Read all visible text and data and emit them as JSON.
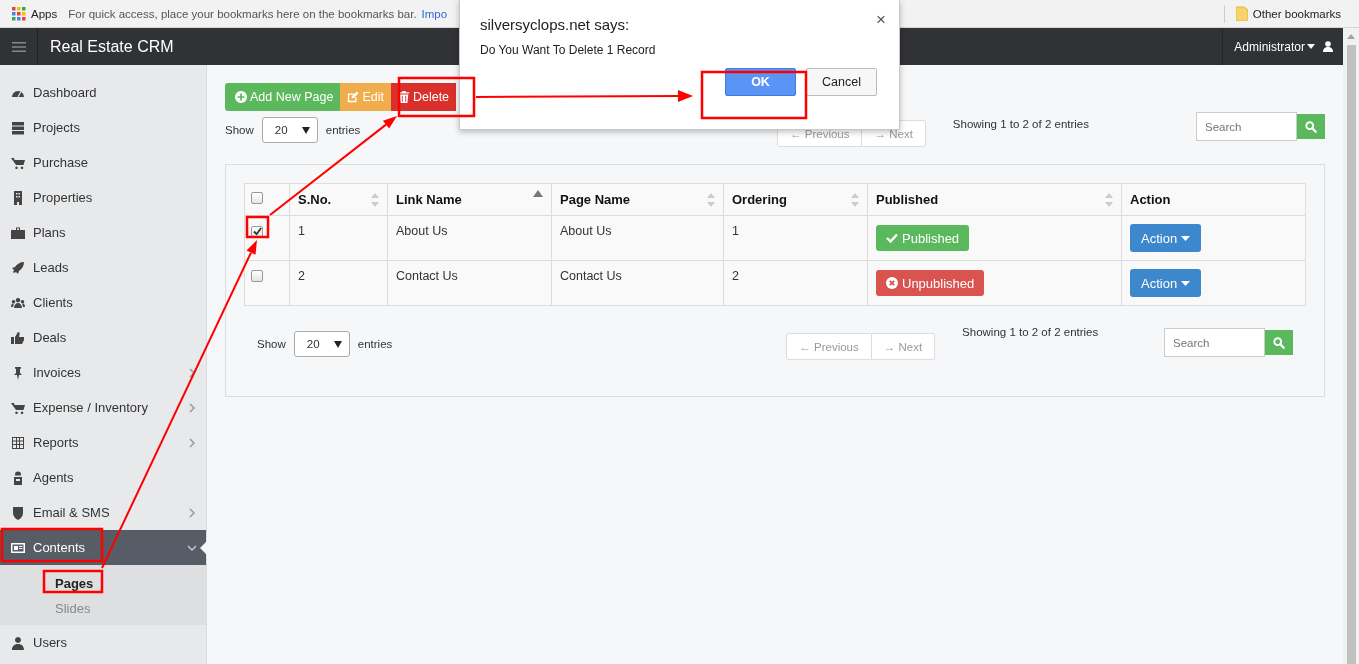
{
  "bookmarks_bar": {
    "apps_label": "Apps",
    "hint": "For quick access, place your bookmarks here on the bookmarks bar.",
    "link": "Impo",
    "other": "Other bookmarks"
  },
  "navbar": {
    "title": "Real Estate CRM",
    "user": "Administrator"
  },
  "sidebar": {
    "items": [
      {
        "label": "Dashboard",
        "selected": false,
        "expandable": false
      },
      {
        "label": "Projects",
        "selected": false,
        "expandable": false
      },
      {
        "label": "Purchase",
        "selected": false,
        "expandable": false
      },
      {
        "label": "Properties",
        "selected": false,
        "expandable": false
      },
      {
        "label": "Plans",
        "selected": false,
        "expandable": false
      },
      {
        "label": "Leads",
        "selected": false,
        "expandable": false
      },
      {
        "label": "Clients",
        "selected": false,
        "expandable": false
      },
      {
        "label": "Deals",
        "selected": false,
        "expandable": false
      },
      {
        "label": "Invoices",
        "selected": false,
        "expandable": true,
        "expanded": false
      },
      {
        "label": "Expense / Inventory",
        "selected": false,
        "expandable": true,
        "expanded": false
      },
      {
        "label": "Reports",
        "selected": false,
        "expandable": true,
        "expanded": false
      },
      {
        "label": "Agents",
        "selected": false,
        "expandable": false
      },
      {
        "label": "Email & SMS",
        "selected": false,
        "expandable": true,
        "expanded": false
      },
      {
        "label": "Contents",
        "selected": true,
        "expandable": true,
        "expanded": true,
        "children": [
          {
            "label": "Pages",
            "selected": true
          },
          {
            "label": "Slides",
            "selected": false
          }
        ]
      },
      {
        "label": "Users",
        "selected": false,
        "expandable": false
      }
    ]
  },
  "toolbar": {
    "buttons": [
      {
        "label": "Add New Page",
        "kind": "add"
      },
      {
        "label": "Edit",
        "kind": "edit"
      },
      {
        "label": "Delete",
        "kind": "delete"
      }
    ]
  },
  "top_controls": {
    "show_label": "Show",
    "page_size": "20",
    "entries_label": "entries",
    "previous": "← Previous",
    "next": "→ Next",
    "pagination_disabled": true,
    "info": "Showing 1 to 2 of 2 entries",
    "search_placeholder": "Search"
  },
  "table": {
    "select_all_checked": false,
    "columns": [
      {
        "label": "S.No.",
        "sortable": true,
        "sorted": false
      },
      {
        "label": "Link Name",
        "sortable": true,
        "sorted": true
      },
      {
        "label": "Page Name",
        "sortable": true,
        "sorted": false
      },
      {
        "label": "Ordering",
        "sortable": true,
        "sorted": false
      },
      {
        "label": "Published",
        "sortable": true,
        "sorted": false
      },
      {
        "label": "Action",
        "sortable": false,
        "sorted": false
      }
    ],
    "rows": [
      {
        "checked": true,
        "sno": "1",
        "link_name": "About Us",
        "page_name": "About Us",
        "ordering": "1",
        "status": {
          "label": "Published",
          "published": true
        },
        "action": "Action"
      },
      {
        "checked": false,
        "sno": "2",
        "link_name": "Contact Us",
        "page_name": "Contact Us",
        "ordering": "2",
        "status": {
          "label": "Unpublished",
          "published": false
        },
        "action": "Action"
      }
    ]
  },
  "bottom_controls": {
    "show_label": "Show",
    "page_size": "20",
    "entries_label": "entries",
    "previous": "← Previous",
    "next": "→ Next",
    "pagination_disabled": true,
    "info": "Showing 1 to 2 of 2 entries",
    "search_placeholder": "Search"
  },
  "dialog": {
    "title": "silversyclops.net says:",
    "close": "×",
    "message": "Do You Want To Delete 1 Record",
    "buttons": [
      {
        "label": "OK",
        "kind": "primary"
      },
      {
        "label": "Cancel",
        "kind": "secondary"
      }
    ]
  }
}
